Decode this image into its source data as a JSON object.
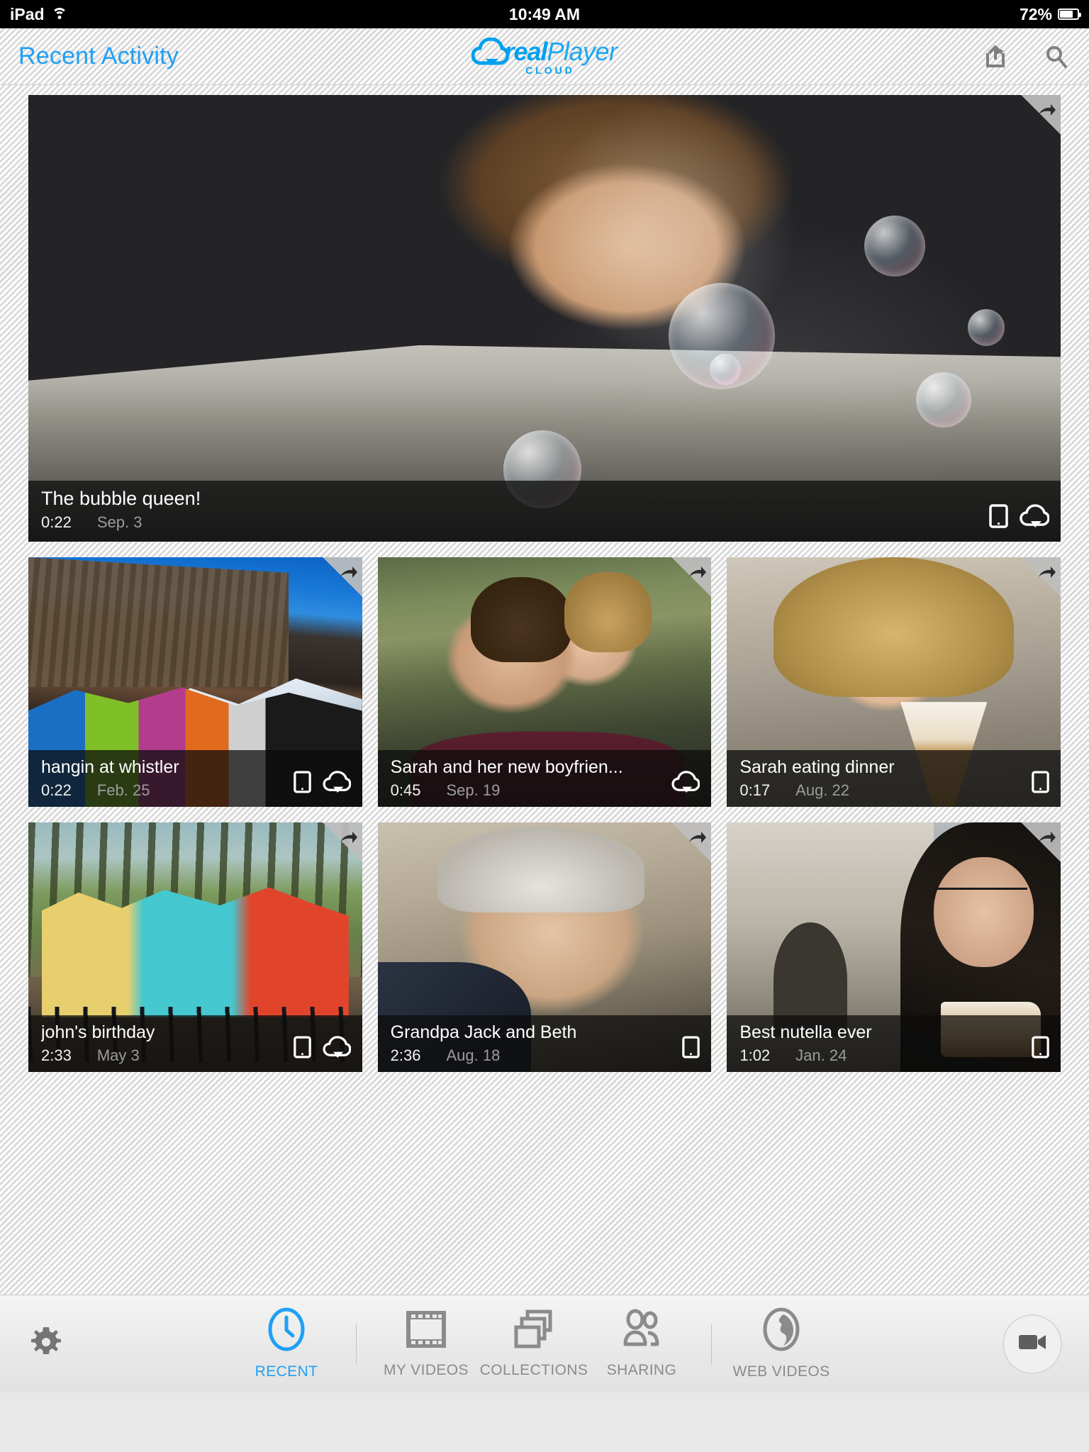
{
  "status_bar": {
    "device": "iPad",
    "wifi_icon": "wifi-icon",
    "time": "10:49 AM",
    "battery_percent": "72%",
    "battery_icon": "battery-icon"
  },
  "nav_bar": {
    "title": "Recent Activity",
    "logo": {
      "cloud_icon": "cloud-logo-icon",
      "word_real": "real",
      "word_player": "Player",
      "word_cloud": "CLOUD"
    },
    "actions": [
      {
        "name": "share-icon",
        "label": "Share"
      },
      {
        "name": "search-icon",
        "label": "Search"
      }
    ]
  },
  "accent_color": "#1fa0f5",
  "videos": [
    {
      "title": "The bubble queen!",
      "duration": "0:22",
      "date": "Sep. 3",
      "badges": [
        "device-icon",
        "cloud-icon"
      ],
      "share_corner": true,
      "photo": "woman-blowing-bubbles-in-car"
    },
    {
      "title": "hangin at whistler",
      "duration": "0:22",
      "date": "Feb. 25",
      "badges": [
        "device-icon",
        "cloud-icon"
      ],
      "share_corner": true,
      "photo": "friends-in-ski-gear-on-mountain"
    },
    {
      "title": "Sarah and her new boyfrien...",
      "duration": "0:45",
      "date": "Sep. 19",
      "badges": [
        "cloud-icon"
      ],
      "share_corner": true,
      "photo": "girl-kissing-boy-on-cheek"
    },
    {
      "title": "Sarah eating dinner",
      "duration": "0:17",
      "date": "Aug. 22",
      "badges": [
        "device-icon"
      ],
      "share_corner": true,
      "photo": "girl-with-ice-cream-cone"
    },
    {
      "title": "john's birthday",
      "duration": "2:33",
      "date": "May 3",
      "badges": [
        "device-icon",
        "cloud-icon"
      ],
      "share_corner": true,
      "photo": "three-women-on-bicycles"
    },
    {
      "title": "Grandpa Jack and Beth",
      "duration": "2:36",
      "date": "Aug. 18",
      "badges": [
        "device-icon"
      ],
      "share_corner": true,
      "photo": "elderly-man-profile"
    },
    {
      "title": "Best nutella ever",
      "duration": "1:02",
      "date": "Jan. 24",
      "badges": [
        "device-icon"
      ],
      "share_corner": true,
      "photo": "woman-eating-crepe-in-street"
    }
  ],
  "tab_bar": {
    "settings_icon": "gear-icon",
    "tabs": [
      {
        "label": "RECENT",
        "icon": "clock-icon",
        "active": true
      },
      {
        "label": "MY VIDEOS",
        "icon": "film-strip-icon",
        "active": false
      },
      {
        "label": "COLLECTIONS",
        "icon": "stacked-windows-icon",
        "active": false
      },
      {
        "label": "SHARING",
        "icon": "people-icon",
        "active": false
      },
      {
        "label": "WEB VIDEOS",
        "icon": "globe-icon",
        "active": false
      }
    ],
    "record_button_icon": "camcorder-icon"
  }
}
